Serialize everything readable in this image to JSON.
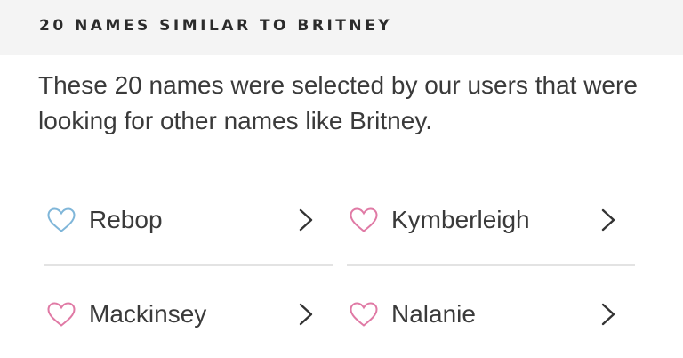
{
  "section": {
    "title": "20 NAMES SIMILAR TO BRITNEY",
    "intro": "These 20 names were selected by our users that were looking for other names like Britney."
  },
  "names": [
    {
      "label": "Rebop",
      "heart_color": "#7fb6d9"
    },
    {
      "label": "Kymberleigh",
      "heart_color": "#e07aa5"
    },
    {
      "label": "Mackinsey",
      "heart_color": "#e07aa5"
    },
    {
      "label": "Nalanie",
      "heart_color": "#e07aa5"
    }
  ],
  "colors": {
    "header_background": "#f4f4f4",
    "divider": "#e3e3e3",
    "text": "#3a3a3a"
  }
}
